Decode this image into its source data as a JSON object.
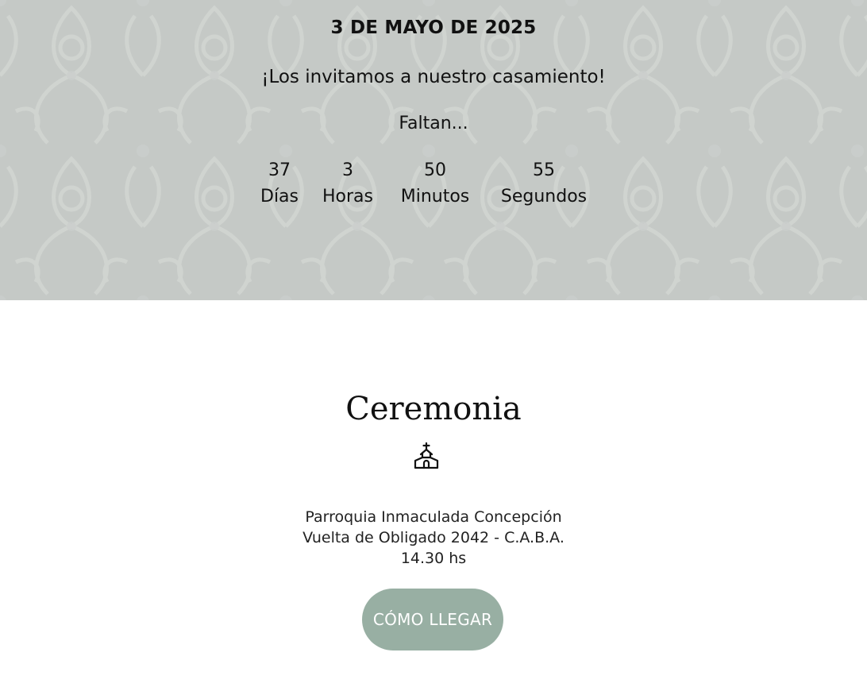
{
  "hero": {
    "date": "3 DE MAYO DE 2025",
    "invite": "¡Los invitamos a nuestro casamiento!",
    "countdown_intro": "Faltan...",
    "countdown": [
      {
        "value": "37",
        "label": "Días"
      },
      {
        "value": "3",
        "label": "Horas"
      },
      {
        "value": "50",
        "label": "Minutos"
      },
      {
        "value": "55",
        "label": "Segundos"
      }
    ]
  },
  "ceremony": {
    "title": "Ceremonia",
    "icon": "church-icon",
    "venue_name": "Parroquia Inmaculada Concepción",
    "address": "Vuelta de Obligado 2042 - C.A.B.A.",
    "time": "14.30 hs",
    "directions_button": "CÓMO LLEGAR"
  },
  "colors": {
    "hero_background": "#c5c9c6",
    "button_background": "#98afa3",
    "button_text": "#ffffff"
  }
}
